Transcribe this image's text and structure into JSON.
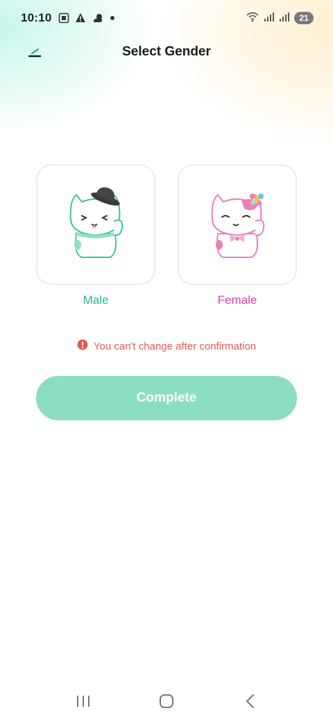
{
  "status_bar": {
    "time": "10:10",
    "battery": "21",
    "left_icons": [
      "screenshot-icon",
      "alert-triangle-icon",
      "weather-icon",
      "dot-icon"
    ],
    "right_icons": [
      "wifi-icon",
      "signal-icon",
      "signal-icon"
    ]
  },
  "header": {
    "title": "Select Gender",
    "back_icon": "back-arrow-icon"
  },
  "options": {
    "male": {
      "label": "Male",
      "color": "#2fb28c",
      "icon": "cat-with-hat"
    },
    "female": {
      "label": "Female",
      "color": "#e041a3",
      "icon": "cat-with-flower"
    }
  },
  "warning": {
    "text": "You can't change after confirmation",
    "color": "#e05c55",
    "icon": "exclamation-circle-icon"
  },
  "complete_button": {
    "label": "Complete",
    "color": "#8cdec3"
  },
  "nav_bar": {
    "icons": [
      "recent-apps-icon",
      "home-icon",
      "back-icon"
    ]
  }
}
